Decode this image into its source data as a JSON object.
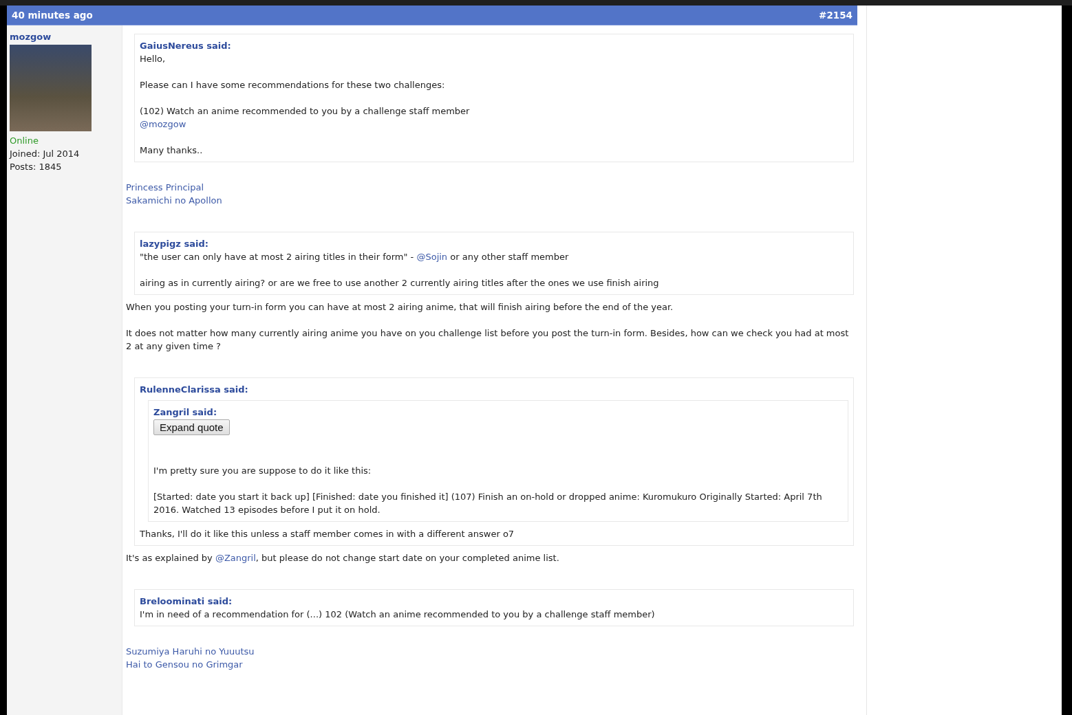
{
  "post": {
    "time": "40 minutes ago",
    "number": "#2154"
  },
  "author": {
    "name": "mozgow",
    "status": "Online",
    "online": true,
    "joined": "Joined: Jul 2014",
    "posts": "Posts: 1845"
  },
  "body": [
    {
      "kind": "quote",
      "author": "GaiusNereus said:",
      "content": [
        {
          "kind": "paragraph",
          "lines": [
            [
              {
                "text": "Hello,",
                "link": false
              }
            ]
          ]
        },
        {
          "kind": "paragraph",
          "lines": [
            [
              {
                "text": "Please can I have some recommendations for these two challenges:",
                "link": false
              }
            ]
          ]
        },
        {
          "kind": "paragraph",
          "lines": [
            [
              {
                "text": "(102) Watch an anime recommended to you by a challenge staff member",
                "link": false
              }
            ],
            [
              {
                "text": "@mozgow",
                "link": true
              }
            ]
          ]
        },
        {
          "kind": "paragraph",
          "lines": [
            [
              {
                "text": "Many thanks..",
                "link": false
              }
            ]
          ]
        }
      ]
    },
    {
      "kind": "links",
      "items": [
        "Princess Principal",
        "Sakamichi no Apollon"
      ]
    },
    {
      "kind": "quote",
      "author": "lazypigz said:",
      "content": [
        {
          "kind": "paragraph",
          "lines": [
            [
              {
                "text": "\"the user can only have at most 2 airing titles in their form\" - ",
                "link": false
              },
              {
                "text": "@Sojin",
                "link": true
              },
              {
                "text": " or any other staff member",
                "link": false
              }
            ]
          ]
        },
        {
          "kind": "paragraph",
          "lines": [
            [
              {
                "text": "airing as in currently airing? or are we free to use another 2 currently airing titles after the ones we use finish airing",
                "link": false
              }
            ]
          ]
        }
      ]
    },
    {
      "kind": "paragraph",
      "lines": [
        [
          {
            "text": "When you posting your turn-in form you can have at most 2 airing anime, that will finish airing before the end of the year.",
            "link": false
          }
        ]
      ]
    },
    {
      "kind": "paragraph",
      "lines": [
        [
          {
            "text": "It does not matter how many currently airing anime you have on you challenge list before you post the turn-in form. Besides, how can we check you had at most 2 at any given time ?",
            "link": false
          }
        ]
      ]
    },
    {
      "kind": "quote",
      "author": "RulenneClarissa said:",
      "content": [
        {
          "kind": "quote",
          "author": "Zangril said:",
          "content": [
            {
              "kind": "button",
              "label": "Expand quote"
            },
            {
              "kind": "paragraph",
              "lines": [
                [
                  {
                    "text": "I'm pretty sure you are suppose to do it like this:",
                    "link": false
                  }
                ]
              ]
            },
            {
              "kind": "paragraph",
              "lines": [
                [
                  {
                    "text": "[Started: date you start it back up] [Finished: date you finished it] (107) Finish an on-hold or dropped anime: Kuromukuro Originally Started: April 7th 2016. Watched 13 episodes before I put it on hold.",
                    "link": false
                  }
                ]
              ]
            }
          ]
        },
        {
          "kind": "paragraph",
          "lines": [
            [
              {
                "text": "Thanks, I'll do it like this unless a staff member comes in with a different answer o7",
                "link": false
              }
            ]
          ]
        }
      ]
    },
    {
      "kind": "paragraph",
      "lines": [
        [
          {
            "text": "It's as explained by ",
            "link": false
          },
          {
            "text": "@Zangril",
            "link": true
          },
          {
            "text": ", but please do not change start date on your completed anime list.",
            "link": false
          }
        ]
      ]
    },
    {
      "kind": "quote",
      "author": "Breloominati said:",
      "content": [
        {
          "kind": "paragraph",
          "lines": [
            [
              {
                "text": "I'm in need of a recommendation for (...) 102 (Watch an anime recommended to you by a challenge staff member)",
                "link": false
              }
            ]
          ]
        }
      ]
    },
    {
      "kind": "links",
      "items": [
        "Suzumiya Haruhi no Yuuutsu",
        "Hai to Gensou no Grimgar"
      ]
    }
  ]
}
